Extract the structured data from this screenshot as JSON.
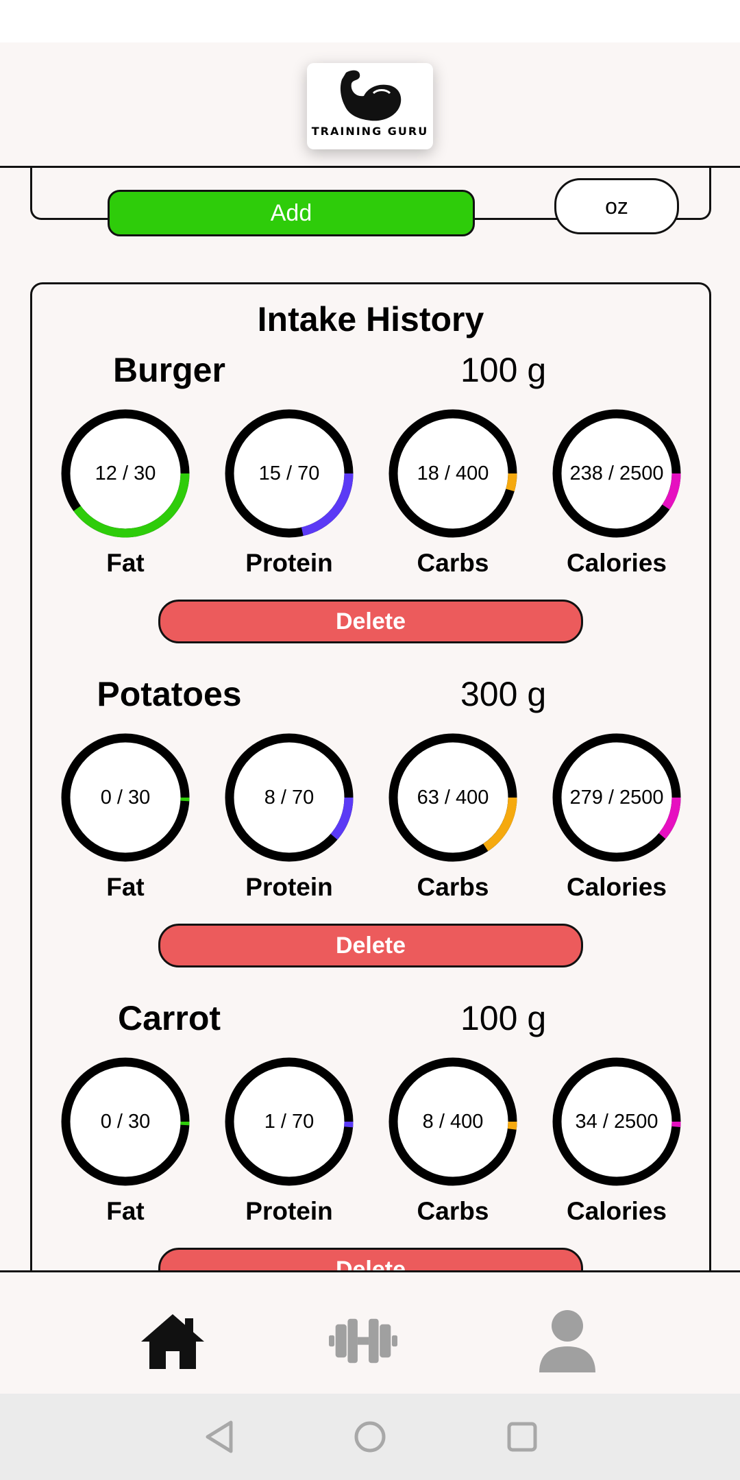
{
  "app": {
    "logo_text": "TRAINING GURU"
  },
  "add_form": {
    "add_label": "Add",
    "unit_label": "oz"
  },
  "history": {
    "title": "Intake History",
    "delete_label": "Delete",
    "entries": [
      {
        "name": "Burger",
        "quantity": "100 g",
        "metrics": [
          {
            "label": "Fat",
            "value": 12,
            "goal": 30,
            "display": "12 / 30",
            "color": "#2ecc0a"
          },
          {
            "label": "Protein",
            "value": 15,
            "goal": 70,
            "display": "15 / 70",
            "color": "#5b3af5"
          },
          {
            "label": "Carbs",
            "value": 18,
            "goal": 400,
            "display": "18 / 400",
            "color": "#f5a90f"
          },
          {
            "label": "Calories",
            "value": 238,
            "goal": 2500,
            "display": "238 / 2500",
            "color": "#e610c0"
          }
        ]
      },
      {
        "name": "Potatoes",
        "quantity": "300 g",
        "metrics": [
          {
            "label": "Fat",
            "value": 0,
            "goal": 30,
            "display": "0 / 30",
            "color": "#2ecc0a"
          },
          {
            "label": "Protein",
            "value": 8,
            "goal": 70,
            "display": "8 / 70",
            "color": "#5b3af5"
          },
          {
            "label": "Carbs",
            "value": 63,
            "goal": 400,
            "display": "63 / 400",
            "color": "#f5a90f"
          },
          {
            "label": "Calories",
            "value": 279,
            "goal": 2500,
            "display": "279 / 2500",
            "color": "#e610c0"
          }
        ]
      },
      {
        "name": "Carrot",
        "quantity": "100 g",
        "metrics": [
          {
            "label": "Fat",
            "value": 0,
            "goal": 30,
            "display": "0 / 30",
            "color": "#2ecc0a"
          },
          {
            "label": "Protein",
            "value": 1,
            "goal": 70,
            "display": "1 / 70",
            "color": "#5b3af5"
          },
          {
            "label": "Carbs",
            "value": 8,
            "goal": 400,
            "display": "8 / 400",
            "color": "#f5a90f"
          },
          {
            "label": "Calories",
            "value": 34,
            "goal": 2500,
            "display": "34 / 2500",
            "color": "#e610c0"
          }
        ]
      }
    ]
  },
  "nav": {
    "items": [
      {
        "icon": "home-icon",
        "active": true
      },
      {
        "icon": "dumbbell-icon",
        "active": false
      },
      {
        "icon": "profile-icon",
        "active": false
      }
    ]
  },
  "system_nav": {
    "icons": [
      "back-icon",
      "home-circle-icon",
      "recents-icon"
    ]
  }
}
